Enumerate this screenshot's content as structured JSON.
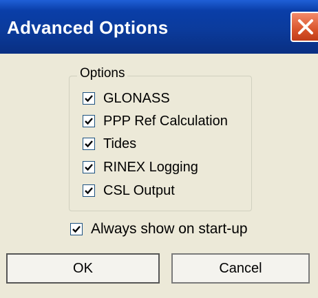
{
  "window": {
    "title": "Advanced Options"
  },
  "options_group": {
    "legend": "Options",
    "items": [
      {
        "label": "GLONASS",
        "checked": true
      },
      {
        "label": "PPP Ref Calculation",
        "checked": true
      },
      {
        "label": "Tides",
        "checked": true
      },
      {
        "label": "RINEX Logging",
        "checked": true
      },
      {
        "label": "CSL Output",
        "checked": true
      }
    ]
  },
  "startup": {
    "label": "Always show on start-up",
    "checked": true
  },
  "buttons": {
    "ok_label": "OK",
    "cancel_label": "Cancel"
  },
  "colors": {
    "titlebar": "#0a3ea8",
    "close_button": "#d9542b",
    "dialog_background": "#ece9d8"
  },
  "icons": {
    "close": "close-icon",
    "check": "checkmark-icon"
  }
}
